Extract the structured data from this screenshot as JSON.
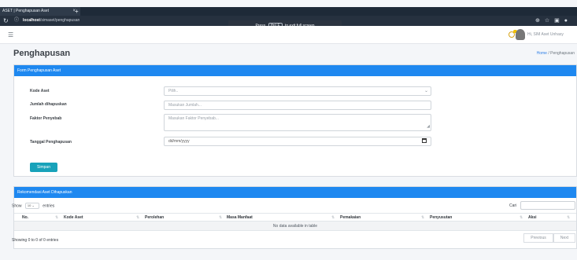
{
  "browser": {
    "tab_title": "ASET | Penghapusan Aset",
    "tab_close": "×",
    "new_tab": "+",
    "url_host": "localhost",
    "url_path": "/simaset/penghapusan",
    "fullscreen_notice_before": "Press",
    "fullscreen_key": "(fn) F",
    "fullscreen_notice_after": "to exit full screen"
  },
  "topbar": {
    "greeting": "Hi, SIM Aset Unhasy"
  },
  "page": {
    "title": "Penghapusan",
    "breadcrumb_home": "Home",
    "breadcrumb_separator": "/",
    "breadcrumb_current": "Penghapusan"
  },
  "form": {
    "header": "Form Penghapusan Aset",
    "kode_label": "Kode Aset",
    "kode_value": "Pilih..",
    "jumlah_label": "Jumlah dihapuskan",
    "jumlah_placeholder": "Masukan Jumlah...",
    "faktor_label": "Faktor Penyebab",
    "faktor_placeholder": "Masukan Faktor Penyebab...",
    "tanggal_label": "Tanggal Penghapusan",
    "tanggal_placeholder": "dd/mm/yyyy",
    "submit": "Simpan"
  },
  "table": {
    "header": "Rekomendasi Aset Dihapuskan",
    "show_label": "Show",
    "entries_value": "10",
    "entries_label": "entries",
    "search_label": "Cari",
    "columns": [
      "No.",
      "Kode Aset",
      "Perolehan",
      "Masa Manfaat",
      "Pemakaian",
      "Penyusutan",
      "Aksi"
    ],
    "empty_text": "No data available in table",
    "info": "Showing 0 to 0 of 0 entries",
    "previous": "Previous",
    "next": "Next"
  }
}
